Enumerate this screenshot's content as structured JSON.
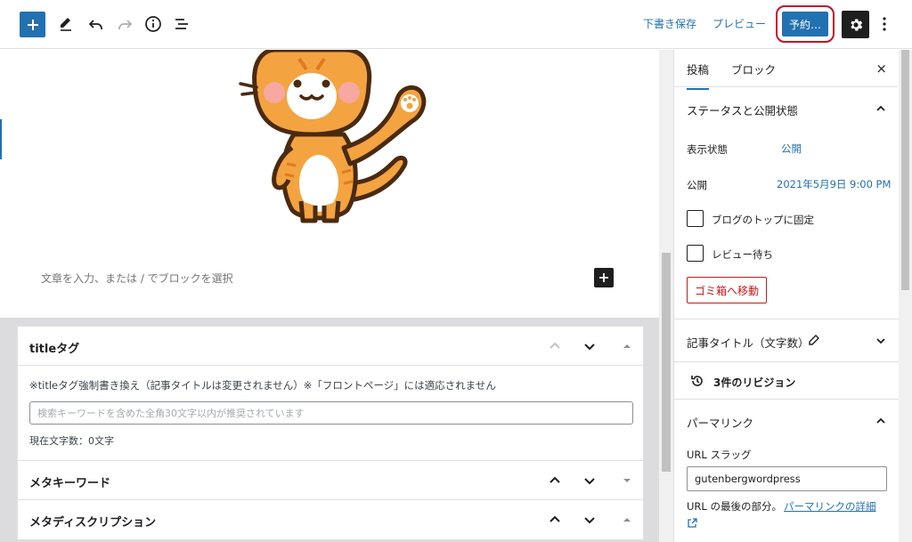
{
  "toolbar": {
    "add_icon": "plus-icon",
    "tools_icon": "pencil-icon",
    "undo_icon": "undo-icon",
    "redo_icon": "redo-icon",
    "info_icon": "info-icon",
    "outline_icon": "list-view-icon",
    "save_draft": "下書き保存",
    "preview": "プレビュー",
    "schedule": "予約…",
    "settings_icon": "gear-icon",
    "more_icon": "kebab-icon",
    "accent_color": "#2271b1",
    "highlight_color": "#c8102e"
  },
  "editor": {
    "image_alt": "cat-illustration",
    "paragraph_placeholder": "文章を入力、または / でブロックを選択"
  },
  "meta_boxes": [
    {
      "title": "titleタグ",
      "note": "※titleタグ強制書き換え（記事タイトルは変更されません）※「フロントページ」には適応されません",
      "input_placeholder": "検索キーワードを含めた全角30文字以内が推奨されています",
      "char_count": "現在文字数：0文字"
    },
    {
      "title": "メタキーワード"
    },
    {
      "title": "メタディスクリプション"
    }
  ],
  "sidebar": {
    "tab_post": "投稿",
    "tab_block": "ブロック",
    "close": "×",
    "status_title": "ステータスと公開状態",
    "visibility_label": "表示状態",
    "visibility_value": "公開",
    "publish_label": "公開",
    "publish_value": "2021年5月9日 9:00 PM",
    "stick_label": "ブログのトップに固定",
    "pending_label": "レビュー待ち",
    "trash": "ゴミ箱へ移動",
    "title_count_label": "記事タイトル（文字数）",
    "revisions": "3件のリビジョン",
    "permalink_title": "パーマリンク",
    "url_slug_label": "URL スラッグ",
    "url_slug_value": "gutenbergwordpress",
    "url_note": "URL の最後の部分。",
    "permalink_link": "パーマリンクの詳細"
  }
}
